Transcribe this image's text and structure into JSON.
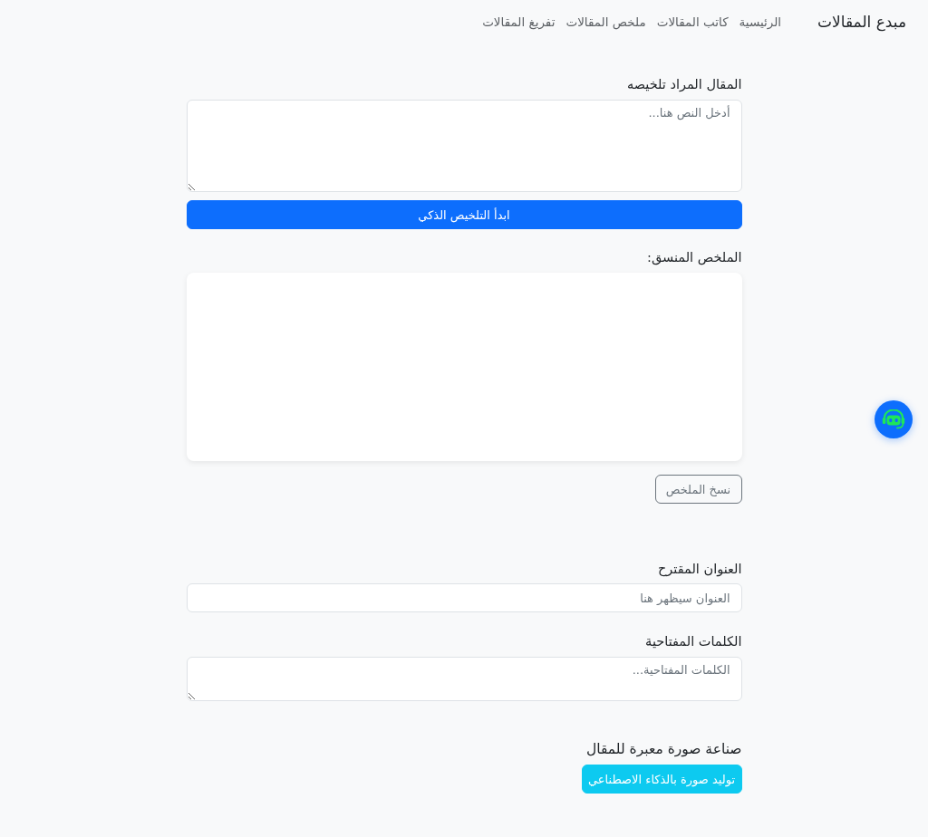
{
  "navbar": {
    "brand": "مبدع المقالات",
    "links": [
      "الرئيسية",
      "كاتب المقالات",
      "ملخص المقالات",
      "تفريغ المقالات"
    ]
  },
  "article_input": {
    "label": "المقال المراد تلخيصه",
    "placeholder": "أدخل النص هنا...",
    "button": "ابدأ التلخيص الذكي"
  },
  "summary": {
    "label": "الملخص المنسق:",
    "copy_button": "نسخ الملخص"
  },
  "title_field": {
    "label": "العنوان المقترح",
    "placeholder": "العنوان سيظهر هنا"
  },
  "keywords_field": {
    "label": "الكلمات المفتاحية",
    "placeholder": "الكلمات المفتاحية..."
  },
  "image_section": {
    "heading": "صناعة صورة معبرة للمقال",
    "button": "توليد صورة بالذكاء الاصطناعي"
  }
}
